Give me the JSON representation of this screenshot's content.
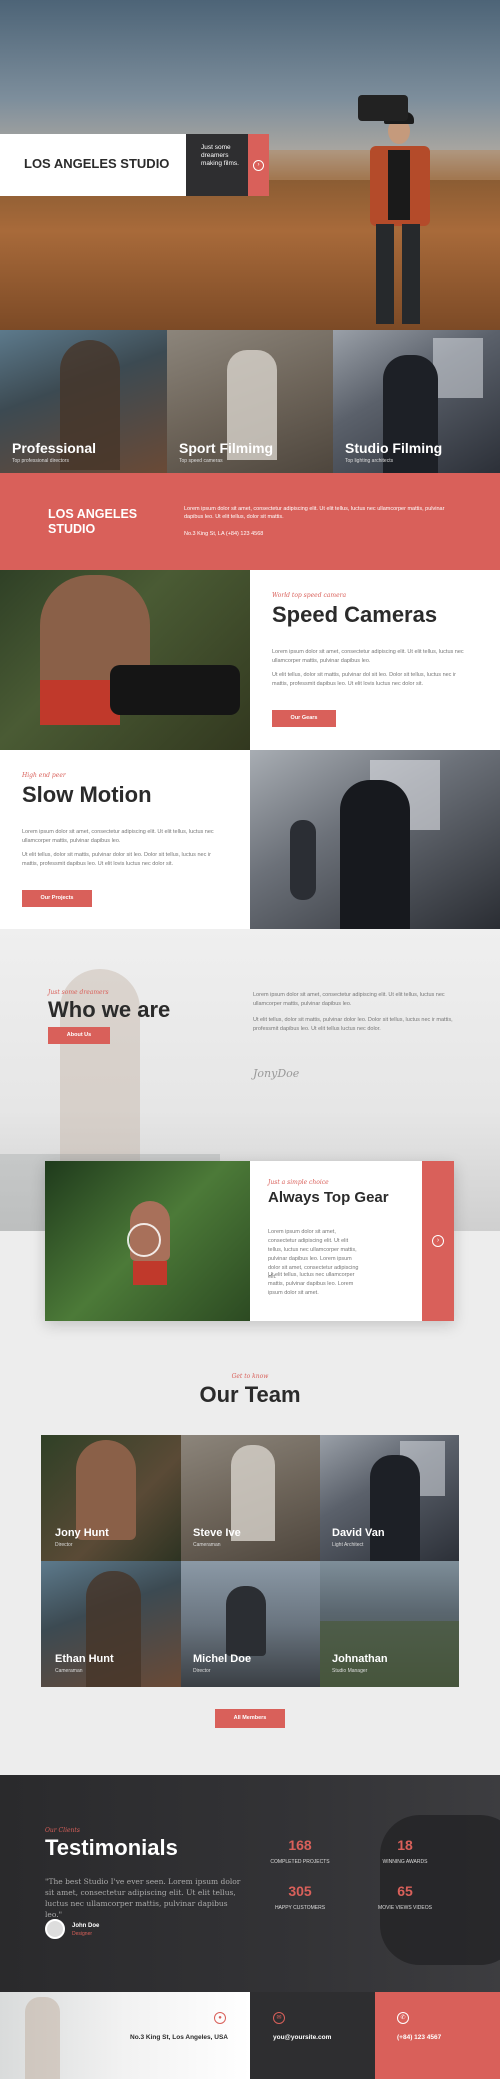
{
  "colors": {
    "accent": "#d9605a",
    "dark": "#2e2e30",
    "light": "#ededed"
  },
  "hero": {
    "title": "LOS ANGELES STUDIO",
    "tagline": "Just some dreamers making films.",
    "arrow_icon": "arrow-right-icon"
  },
  "services": [
    {
      "title": "Professional",
      "subtitle": "Top professional directors"
    },
    {
      "title": "Sport Filmimg",
      "subtitle": "Top speed cameras"
    },
    {
      "title": "Studio Filming",
      "subtitle": "Top lighting architects"
    }
  ],
  "banner": {
    "title": "LOS ANGELES STUDIO",
    "text": "Lorem ipsum dolor sit amet, consectetur adipiscing elit. Ut elit tellus, luctus nec ullamcorper mattis, pulvinar dapibus leo. Ut elit tellus, dolor sit mattis.",
    "contact": "No.3 King St, LA  (+84) 123 4568"
  },
  "speed": {
    "kicker": "World top speed camera",
    "title": "Speed Cameras",
    "p1": "Lorem ipsum dolor sit amet, consectetur adipiscing elit. Ut elit tellus, luctus nec ullamcorper mattis, pulvinar dapibus leo.",
    "p2": "Ut elit tellus, dolor sit mattis, pulvinar dol sit leo. Dolor sit tellus, luctus nec ir mattis, professmit dapibus leo. Ut elit lovis luctus nec dolor sit.",
    "button": "Our Gears"
  },
  "slow": {
    "kicker": "High end peer",
    "title": "Slow Motion",
    "p1": "Lorem ipsum dolor sit amet, consectetur adipiscing elit. Ut elit tellus, luctus nec ullamcorper mattis, pulvinar dapibus leo.",
    "p2": "Ut elit tellus, dolor sit mattis, pulvinar dolor sit leo. Dolor sit tellus, luctus nec ir mattis, professmit dapibus leo. Ut elit lovis luctus nec dolor sit.",
    "button": "Our Projects"
  },
  "who": {
    "kicker": "Just some dreamers",
    "title": "Who we are",
    "button": "About Us",
    "p1": "Lorem ipsum dolor sit amet, consectetur adipiscing elit. Ut elit tellus, luctus nec ullamcorper mattis, pulvinar dapibus leo.",
    "p2": "Ut elit tellus, dolor sit mattis, pulvinar dolor leo. Dolor sit tellus, luctus nec ir mattis, professmit dapibus leo. Ut elit tellus luctus nec dolor.",
    "signature": "JonyDoe"
  },
  "gear": {
    "kicker": "Just a simple choice",
    "title": "Always Top Gear",
    "p1": "Lorem ipsum dolor sit amet, consectetur adipiscing elit. Ut elit tellus, luctus nec ullamcorper mattis, pulvinar dapibus leo. Lorem ipsum dolor sit amet, consectetur adipiscing elit.",
    "p2": "Ut elit tellus, luctus nec ullamcorper mattis, pulvinar dapibus leo. Lorem ipsum dolor sit amet.",
    "arrow_icon": "arrow-right-circle-icon"
  },
  "team": {
    "kicker": "Get to know",
    "title": "Our Team",
    "button": "All Members",
    "members": [
      {
        "name": "Jony Hunt",
        "role": "Director"
      },
      {
        "name": "Steve Ive",
        "role": "Cameraman"
      },
      {
        "name": "David Van",
        "role": "Light Architect"
      },
      {
        "name": "Ethan Hunt",
        "role": "Cameraman"
      },
      {
        "name": "Michel Doe",
        "role": "Director"
      },
      {
        "name": "Johnathan",
        "role": "Studio Manager"
      }
    ]
  },
  "testimonials": {
    "kicker": "Our Clients",
    "title": "Testimonials",
    "quote": "\"The best Studio I've ever seen. Lorem ipsum dolor sit amet, consectetur adipiscing elit. Ut elit tellus, luctus nec ullamcorper mattis, pulvinar dapibus leo.\"",
    "author": "John Doe",
    "author_role": "Designer",
    "stats": [
      {
        "value": "168",
        "label": "COMPLETED PROJECTS"
      },
      {
        "value": "18",
        "label": "WINNING AWARDS"
      },
      {
        "value": "305",
        "label": "HAPPY CUSTOMERS"
      },
      {
        "value": "65",
        "label": "MOVIE VIEWS VIDEOS"
      }
    ]
  },
  "footer": {
    "address": "No.3 King St, Los Angeles, USA",
    "email": "you@yoursite.com",
    "phone": "(+84) 123 4567"
  }
}
